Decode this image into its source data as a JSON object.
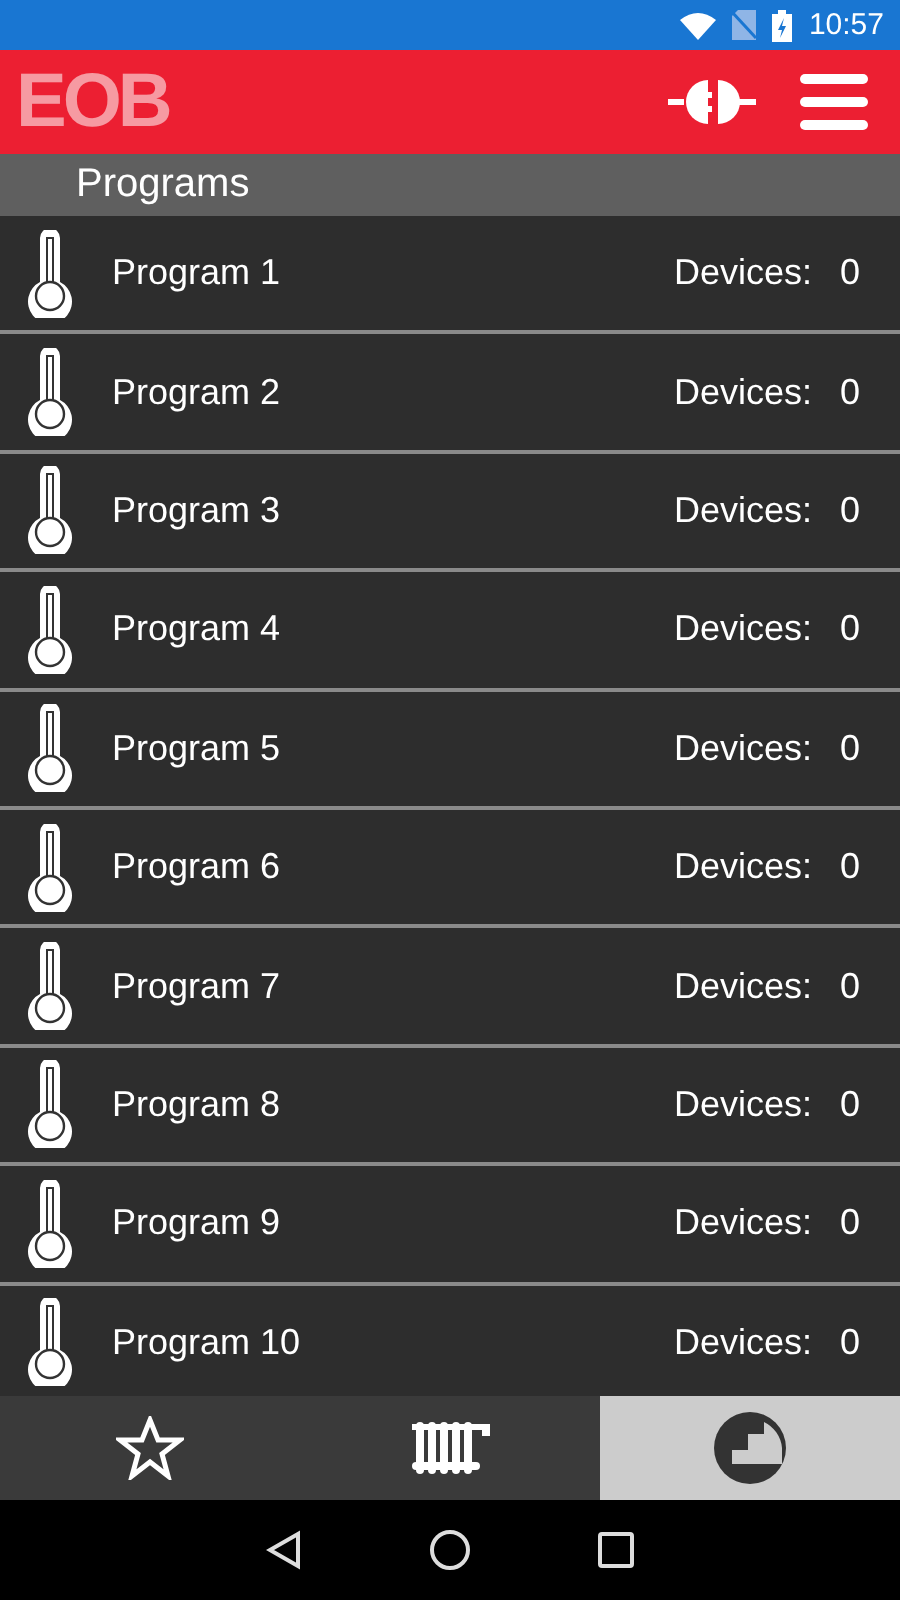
{
  "status_bar": {
    "time": "10:57"
  },
  "app_bar": {
    "logo": "EOB"
  },
  "section": {
    "title": "Programs"
  },
  "programs": [
    {
      "name": "Program 1",
      "devices_label": "Devices:",
      "devices": "0"
    },
    {
      "name": "Program 2",
      "devices_label": "Devices:",
      "devices": "0"
    },
    {
      "name": "Program 3",
      "devices_label": "Devices:",
      "devices": "0"
    },
    {
      "name": "Program 4",
      "devices_label": "Devices:",
      "devices": "0"
    },
    {
      "name": "Program 5",
      "devices_label": "Devices:",
      "devices": "0"
    },
    {
      "name": "Program 6",
      "devices_label": "Devices:",
      "devices": "0"
    },
    {
      "name": "Program 7",
      "devices_label": "Devices:",
      "devices": "0"
    },
    {
      "name": "Program 8",
      "devices_label": "Devices:",
      "devices": "0"
    },
    {
      "name": "Program 9",
      "devices_label": "Devices:",
      "devices": "0"
    },
    {
      "name": "Program 10",
      "devices_label": "Devices:",
      "devices": "0"
    }
  ],
  "tabs": [
    {
      "kind": "favorites",
      "selected": false
    },
    {
      "kind": "radiator",
      "selected": false
    },
    {
      "kind": "programs",
      "selected": true
    }
  ]
}
